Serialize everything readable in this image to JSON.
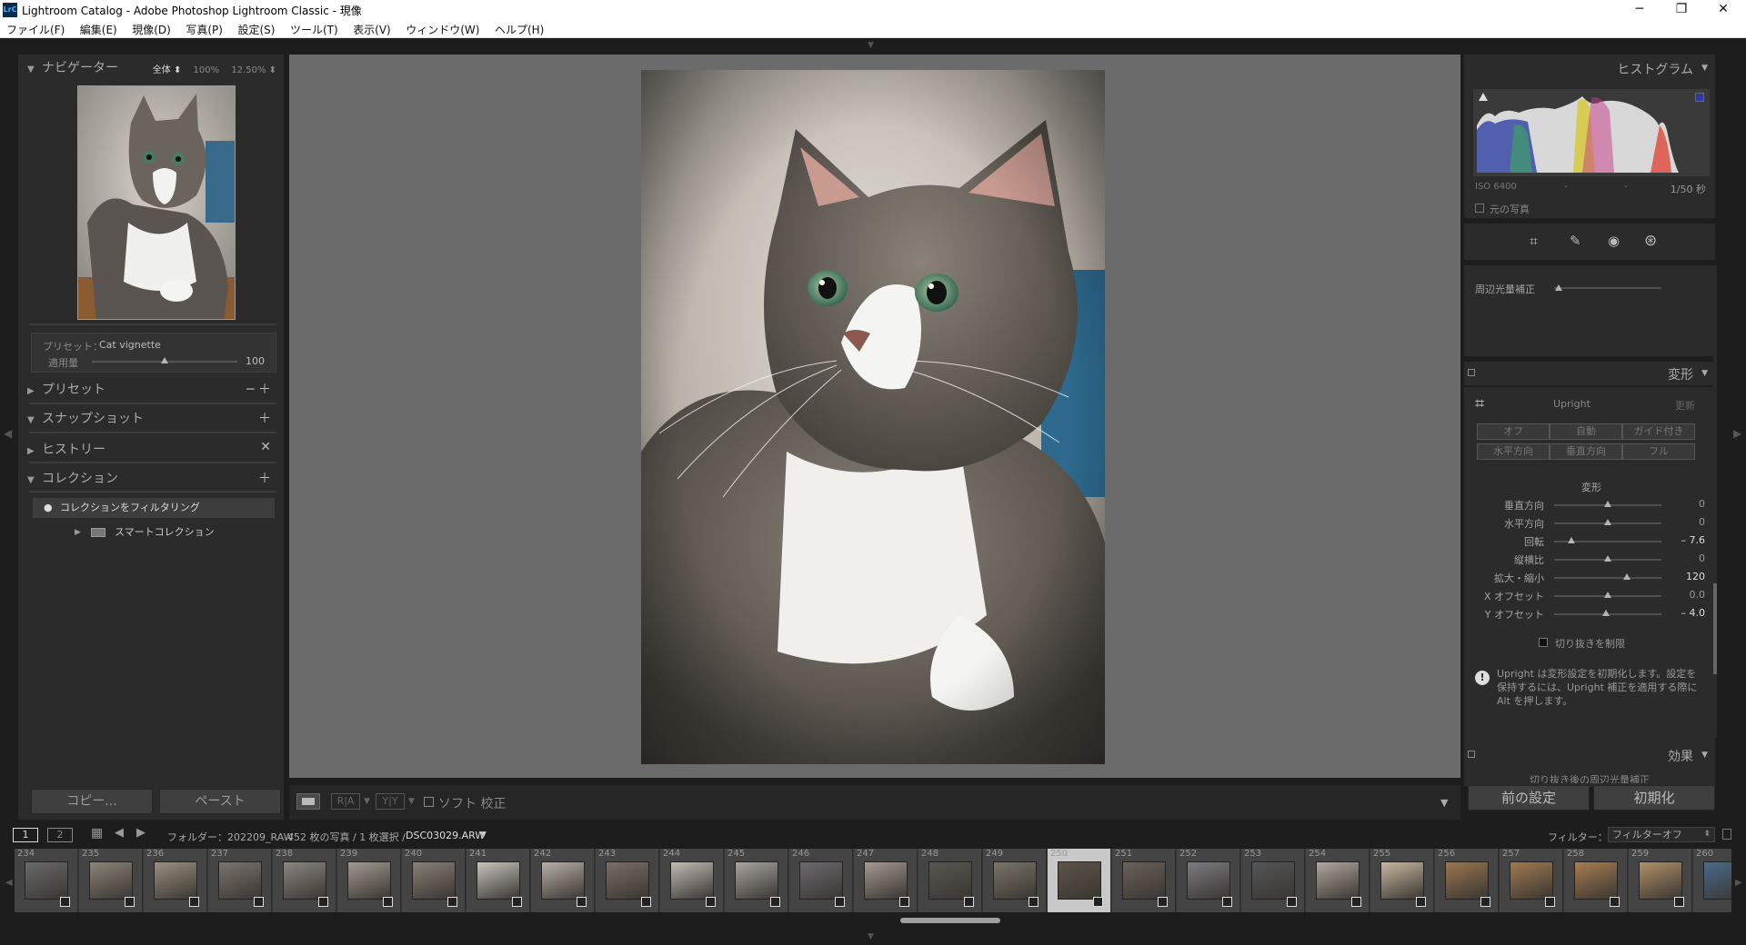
{
  "window": {
    "title": "Lightroom Catalog - Adobe Photoshop Lightroom Classic - 現像",
    "app_icon": "LrC",
    "controls": {
      "minimize": "─",
      "maximize": "❐",
      "close": "✕"
    }
  },
  "menu": [
    "ファイル(F)",
    "編集(E)",
    "現像(D)",
    "写真(P)",
    "設定(S)",
    "ツール(T)",
    "表示(V)",
    "ウィンドウ(W)",
    "ヘルプ(H)"
  ],
  "left": {
    "navigator": {
      "title": "ナビゲーター",
      "opts": [
        "全体 ⬍",
        "100%",
        "12.50% ⬍"
      ]
    },
    "preset_box": {
      "preset_label": "プリセット：",
      "preset_value": "Cat vignette",
      "amount_label": "適用量",
      "amount_value": "100",
      "amount_fraction": 0.5
    },
    "sections": [
      {
        "title": "プリセット",
        "arrow": "▶",
        "right": "─  ＋"
      },
      {
        "title": "スナップショット",
        "arrow": "▼",
        "right": "＋"
      },
      {
        "title": "ヒストリー",
        "arrow": "▶",
        "right": "✕"
      },
      {
        "title": "コレクション",
        "arrow": "▼",
        "right": "＋"
      }
    ],
    "collection_filter": "コレクションをフィルタリング",
    "smart_collection": "スマートコレクション",
    "copy_button": "コピー...",
    "paste_button": "ペースト"
  },
  "toolbar": {
    "ra": "R|A",
    "yy": "Y|Y",
    "soft_proof": "ソフト 校正"
  },
  "right": {
    "histogram": {
      "title": "ヒストグラム",
      "iso": "ISO 6400",
      "dash1": "-",
      "dash2": "-",
      "shutter": "1/50 秒",
      "original_photo": "元の写真"
    },
    "vignette_label": "周辺光量補正",
    "transform": {
      "title": "変形",
      "upright_label": "Upright",
      "update_label": "更新",
      "buttons_row1": [
        "オフ",
        "自動",
        "ガイド付き"
      ],
      "buttons_row2": [
        "水平方向",
        "垂直方向",
        "フル"
      ],
      "section_label": "変形",
      "sliders": [
        {
          "label": "垂直方向",
          "value": "0",
          "pos": 0.5
        },
        {
          "label": "水平方向",
          "value": "0",
          "pos": 0.5
        },
        {
          "label": "回転",
          "value": "– 7.6",
          "pos": 0.16
        },
        {
          "label": "縦横比",
          "value": "0",
          "pos": 0.5
        },
        {
          "label": "拡大・縮小",
          "value": "120",
          "pos": 0.68
        },
        {
          "label": "X オフセット",
          "value": "0.0",
          "pos": 0.5
        },
        {
          "label": "Y オフセット",
          "value": "– 4.0",
          "pos": 0.48
        }
      ],
      "constrain_crop": "切り抜きを制限",
      "note": "Upright は変形設定を初期化します。設定を保持するには、Upright 補正を適用する際に Alt を押します。"
    },
    "effects": {
      "title": "効果",
      "sub": "切り抜き後の周辺光量補正"
    },
    "prev_button": "前の設定",
    "reset_button": "初期化"
  },
  "filmbar": {
    "page1": "1",
    "page2": "2",
    "folder_label": "フォルダー：202209_RAW",
    "count": "452 枚の写真 / 1 枚選択 /",
    "filename": "DSC03029.ARW",
    "filter_label": "フィルター：",
    "filter_value": "フィルターオフ"
  },
  "filmstrip": [
    {
      "num": "234",
      "c": "#6a6a6a"
    },
    {
      "num": "235",
      "c": "#8c8478"
    },
    {
      "num": "236",
      "c": "#9a9080"
    },
    {
      "num": "237",
      "c": "#7a7470"
    },
    {
      "num": "238",
      "c": "#8a8680"
    },
    {
      "num": "239",
      "c": "#a09a90"
    },
    {
      "num": "240",
      "c": "#888078"
    },
    {
      "num": "241",
      "c": "#c8c4bc"
    },
    {
      "num": "242",
      "c": "#b8b0a8"
    },
    {
      "num": "243",
      "c": "#7a6e66"
    },
    {
      "num": "244",
      "c": "#c0bcb4"
    },
    {
      "num": "245",
      "c": "#a8a4a0"
    },
    {
      "num": "246",
      "c": "#6c6a70"
    },
    {
      "num": "247",
      "c": "#a49a90"
    },
    {
      "num": "248",
      "c": "#5a5650"
    },
    {
      "num": "249",
      "c": "#7a7468"
    },
    {
      "num": "250",
      "c": "#5c5448"
    },
    {
      "num": "251",
      "c": "#6a625a"
    },
    {
      "num": "252",
      "c": "#7c7c80"
    },
    {
      "num": "253",
      "c": "#545658"
    },
    {
      "num": "254",
      "c": "#b0a8a0"
    },
    {
      "num": "255",
      "c": "#c8b8a0"
    },
    {
      "num": "256",
      "c": "#9a7650"
    },
    {
      "num": "257",
      "c": "#a07a50"
    },
    {
      "num": "258",
      "c": "#a87e50"
    },
    {
      "num": "259",
      "c": "#b09068"
    },
    {
      "num": "260",
      "c": "#4a6a8a"
    }
  ],
  "colors": {
    "accent": "#cfcfcf",
    "panel": "#2b2b2b",
    "center": "#6b6b6b"
  }
}
